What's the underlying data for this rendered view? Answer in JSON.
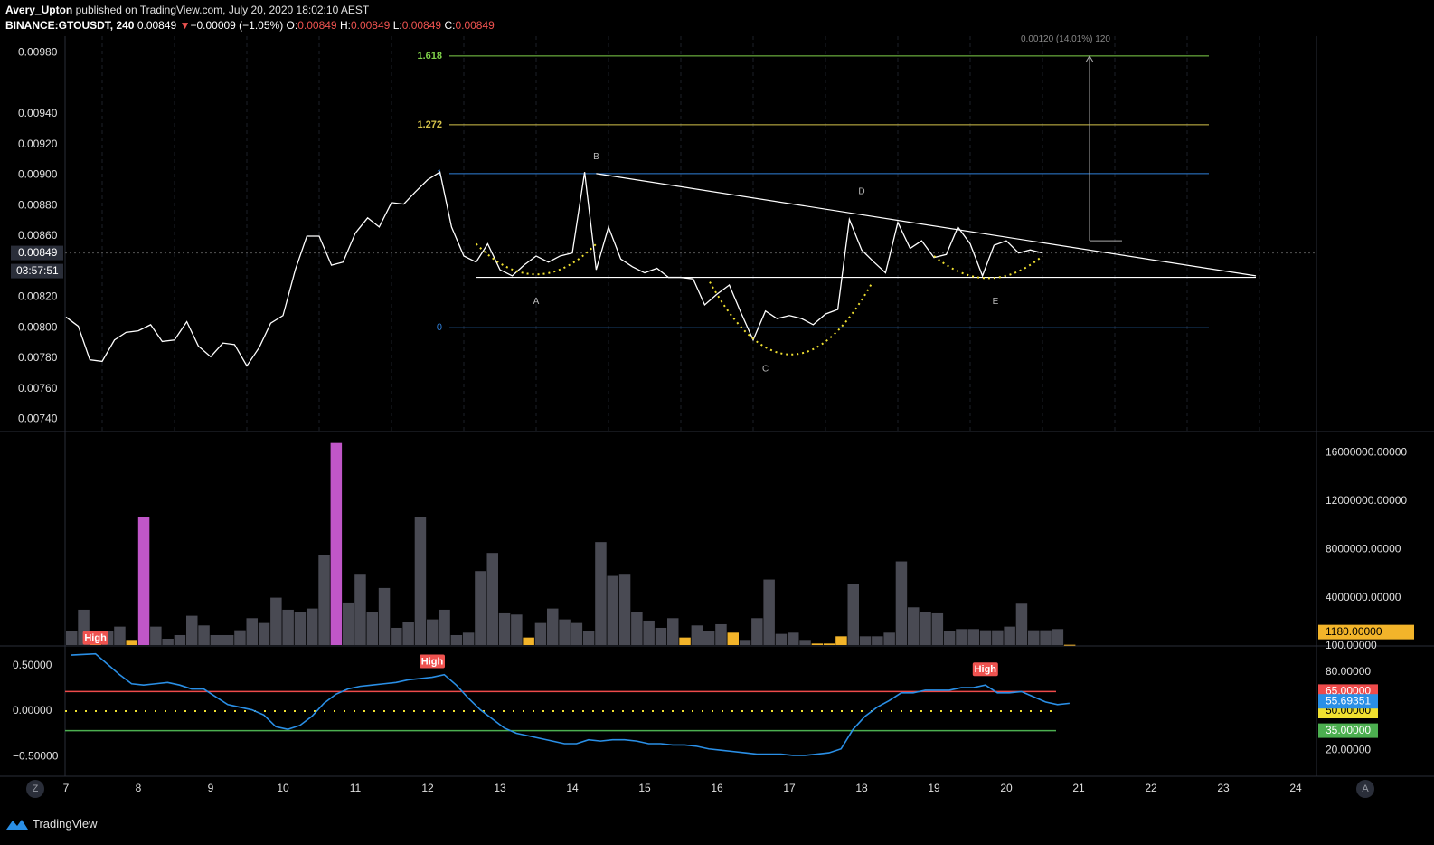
{
  "header": {
    "author": "Avery_Upton",
    "published_text": "published on TradingView.com, July 20, 2020 18:02:10 AEST",
    "symbol": "BINANCE:GTOUSDT, 240",
    "last": "0.00849",
    "change_arrow": "▼",
    "change": "−0.00009 (−1.05%)",
    "o_label": "O:",
    "o": "0.00849",
    "h_label": "H:",
    "h": "0.00849",
    "l_label": "L:",
    "l": "0.00849",
    "c_label": "C:",
    "c": "0.00849"
  },
  "footer": {
    "brand": "TradingView",
    "logo_icon": "tradingview-logo-icon"
  },
  "buttons": {
    "left_circle": "Z",
    "right_circle": "A"
  },
  "colors": {
    "background": "#000000",
    "price_line": "#ffffff",
    "fib_1618": "#7fd14a",
    "fib_1272": "#d4c24a",
    "fib_1": "#2f7fd9",
    "fib_0": "#2f7fd9",
    "arc": "#f0e030",
    "volume_bar": "#494a53",
    "volume_high": "#c056c8",
    "volume_low": "#f2b42a",
    "osc_line": "#2a8fe6",
    "osc_upper": "#ef4b4b",
    "osc_lower": "#4caf50",
    "osc_mid": "#f0e030"
  },
  "chart_data": [
    {
      "type": "line",
      "pane": "price",
      "y_ticks": [
        "0.00980",
        "0.00940",
        "0.00920",
        "0.00900",
        "0.00880",
        "0.00860",
        "0.00820",
        "0.00800",
        "0.00780",
        "0.00760",
        "0.00740"
      ],
      "ylim": [
        0.00732,
        0.00991
      ],
      "last_price_label": "0.00849",
      "countdown_label": "03:57:51",
      "x": [
        7.0,
        7.17,
        7.33,
        7.5,
        7.67,
        7.83,
        8.0,
        8.17,
        8.33,
        8.5,
        8.67,
        8.83,
        9.0,
        9.17,
        9.33,
        9.5,
        9.67,
        9.83,
        10.0,
        10.17,
        10.33,
        10.5,
        10.67,
        10.83,
        11.0,
        11.17,
        11.33,
        11.5,
        11.67,
        11.83,
        12.0,
        12.17,
        12.33,
        12.5,
        12.67,
        12.83,
        13.0,
        13.17,
        13.33,
        13.5,
        13.67,
        13.83,
        14.0,
        14.17,
        14.33,
        14.5,
        14.67,
        14.83,
        15.0,
        15.17,
        15.33,
        15.5,
        15.67,
        15.83,
        16.0,
        16.17,
        16.33,
        16.5,
        16.67,
        16.83,
        17.0,
        17.17,
        17.33,
        17.5,
        17.67,
        17.83,
        18.0,
        18.17,
        18.33,
        18.5,
        18.67,
        18.83,
        19.0,
        19.17,
        19.33,
        19.5,
        19.67,
        19.83,
        20.0,
        20.17,
        20.33,
        20.5
      ],
      "values": [
        0.00807,
        0.00801,
        0.00779,
        0.00778,
        0.00792,
        0.00797,
        0.00798,
        0.00802,
        0.00791,
        0.00792,
        0.00804,
        0.00788,
        0.00781,
        0.0079,
        0.00789,
        0.00775,
        0.00787,
        0.00803,
        0.00808,
        0.00838,
        0.0086,
        0.0086,
        0.00841,
        0.00843,
        0.00862,
        0.00872,
        0.00866,
        0.00882,
        0.00881,
        0.00889,
        0.00897,
        0.00902,
        0.00866,
        0.00847,
        0.00843,
        0.00855,
        0.00838,
        0.00834,
        0.00841,
        0.00847,
        0.00843,
        0.00847,
        0.00849,
        0.00902,
        0.00838,
        0.00866,
        0.00845,
        0.0084,
        0.00836,
        0.00839,
        0.00833,
        0.00833,
        0.00832,
        0.00815,
        0.00822,
        0.00828,
        0.0081,
        0.00792,
        0.00811,
        0.00806,
        0.00808,
        0.00806,
        0.00802,
        0.00809,
        0.00812,
        0.00871,
        0.00851,
        0.00843,
        0.00836,
        0.00869,
        0.00852,
        0.00857,
        0.00846,
        0.00848,
        0.00866,
        0.00855,
        0.00834,
        0.00854,
        0.00857,
        0.00849,
        0.00851,
        0.00849
      ],
      "fib_levels": [
        {
          "label": "1.618",
          "price": 0.00978
        },
        {
          "label": "1.272",
          "price": 0.00933
        },
        {
          "label": "1",
          "price": 0.00901
        },
        {
          "label": "0",
          "price": 0.008
        }
      ],
      "annotations": [
        {
          "text": "A",
          "x": 13.5,
          "price": 0.00817
        },
        {
          "text": "B",
          "x": 14.33,
          "price": 0.00912
        },
        {
          "text": "C",
          "x": 16.67,
          "price": 0.00773
        },
        {
          "text": "D",
          "x": 18.0,
          "price": 0.00889
        },
        {
          "text": "E",
          "x": 19.85,
          "price": 0.00817
        }
      ],
      "measure_label": "0.00120 (14.01%) 120"
    },
    {
      "type": "bar",
      "pane": "volume",
      "y_ticks": [
        "16000000.00000",
        "12000000.00000",
        "8000000.00000",
        "4000000.00000"
      ],
      "ylim": [
        0,
        17000000
      ],
      "last_volume_label": "1180.00000",
      "values": [
        1200000,
        3000000,
        500000,
        1200000,
        1600000,
        500000,
        10700000,
        1600000,
        600000,
        900000,
        2500000,
        1700000,
        900000,
        900000,
        1300000,
        2300000,
        1900000,
        4000000,
        3000000,
        2800000,
        3100000,
        7500000,
        16800000,
        3600000,
        5900000,
        2800000,
        4800000,
        1500000,
        2000000,
        10700000,
        2200000,
        3000000,
        900000,
        1100000,
        6200000,
        7700000,
        2700000,
        2600000,
        700000,
        1900000,
        3100000,
        2200000,
        1900000,
        1200000,
        8600000,
        5800000,
        5900000,
        2800000,
        2100000,
        1500000,
        2300000,
        700000,
        1700000,
        1200000,
        1800000,
        1100000,
        500000,
        2300000,
        5500000,
        1000000,
        1100000,
        500000,
        200000,
        200000,
        800000,
        5100000,
        800000,
        800000,
        1100000,
        7000000,
        3200000,
        2800000,
        2700000,
        1200000,
        1400000,
        1400000,
        1300000,
        1300000,
        1600000,
        3500000,
        1300000,
        1300000,
        1400000,
        100000
      ],
      "highlight_purple": [
        6,
        22
      ],
      "highlight_yellow": [
        2,
        5,
        38,
        51,
        55,
        62,
        63,
        64,
        83
      ]
    },
    {
      "type": "line",
      "pane": "oscillator",
      "y_ticks": [
        "0.50000",
        "0.00000",
        "−0.50000"
      ],
      "right_ticks": [
        "100.00000",
        "80.00000",
        "20.00000"
      ],
      "ylim": [
        0,
        100
      ],
      "x": [
        0,
        2,
        3,
        4,
        5,
        6,
        7,
        8,
        9,
        10,
        11,
        12,
        13,
        14,
        15,
        16,
        17,
        18,
        19,
        20,
        21,
        22,
        23,
        24,
        25,
        26,
        27,
        28,
        29,
        30,
        31,
        32,
        33,
        34,
        35,
        36,
        37,
        38,
        39,
        40,
        41,
        42,
        43,
        44,
        45,
        46,
        47,
        48,
        49,
        50,
        51,
        52,
        53,
        54,
        55,
        56,
        57,
        58,
        59,
        60,
        61,
        62,
        63,
        64,
        65,
        66,
        67,
        68,
        69,
        70,
        71,
        72,
        73,
        74,
        75,
        76,
        77,
        78,
        79,
        80,
        81,
        82,
        83
      ],
      "values": [
        93,
        94,
        86,
        78,
        71,
        70,
        71,
        72,
        70,
        67,
        67,
        61,
        55,
        53,
        51,
        47,
        38,
        36,
        39,
        46,
        56,
        63,
        67,
        69,
        70,
        71,
        72,
        74,
        75,
        76,
        78,
        70,
        60,
        51,
        44,
        37,
        33,
        31,
        29,
        27,
        25,
        25,
        28,
        27,
        28,
        28,
        27,
        25,
        25,
        24,
        24,
        23,
        21,
        20,
        19,
        18,
        17,
        17,
        17,
        16,
        16,
        17,
        18,
        21,
        36,
        46,
        53,
        58,
        64,
        64,
        66,
        66,
        66,
        68,
        68,
        70,
        64,
        64,
        65,
        61,
        57,
        55,
        56
      ],
      "reference_levels": [
        {
          "label": "65.00000",
          "value": 65
        },
        {
          "label": "50.00000",
          "value": 50
        },
        {
          "label": "35.00000",
          "value": 35
        }
      ],
      "current_label": "55.69351",
      "signals": [
        {
          "text": "High",
          "index": 2
        },
        {
          "text": "High",
          "index": 30
        },
        {
          "text": "High",
          "index": 76
        }
      ]
    }
  ],
  "x_axis": {
    "ticks": [
      "7",
      "8",
      "9",
      "10",
      "11",
      "12",
      "13",
      "14",
      "15",
      "16",
      "17",
      "18",
      "19",
      "20",
      "21",
      "22",
      "23",
      "24"
    ]
  }
}
